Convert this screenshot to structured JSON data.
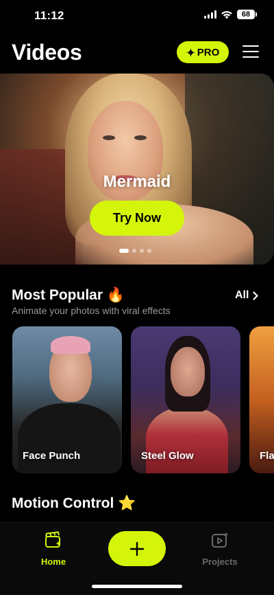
{
  "status_bar": {
    "time": "11:12",
    "battery": "68"
  },
  "header": {
    "title": "Videos",
    "pro_label": "PRO",
    "pro_icon": "sparkle-icon"
  },
  "hero": {
    "title": "Mermaid",
    "button_label": "Try Now",
    "pages": 4,
    "active_page": 1
  },
  "most_popular": {
    "title": "Most Popular 🔥",
    "subtitle": "Animate your photos with viral effects",
    "all_label": "All",
    "cards": [
      {
        "label": "Face Punch"
      },
      {
        "label": "Steel Glow"
      },
      {
        "label": "Fla"
      }
    ]
  },
  "motion_control": {
    "title": "Motion Control ⭐"
  },
  "tab_bar": {
    "home_label": "Home",
    "projects_label": "Projects",
    "accent_color": "#d4f50a",
    "inactive_color": "#6a6a6a"
  }
}
